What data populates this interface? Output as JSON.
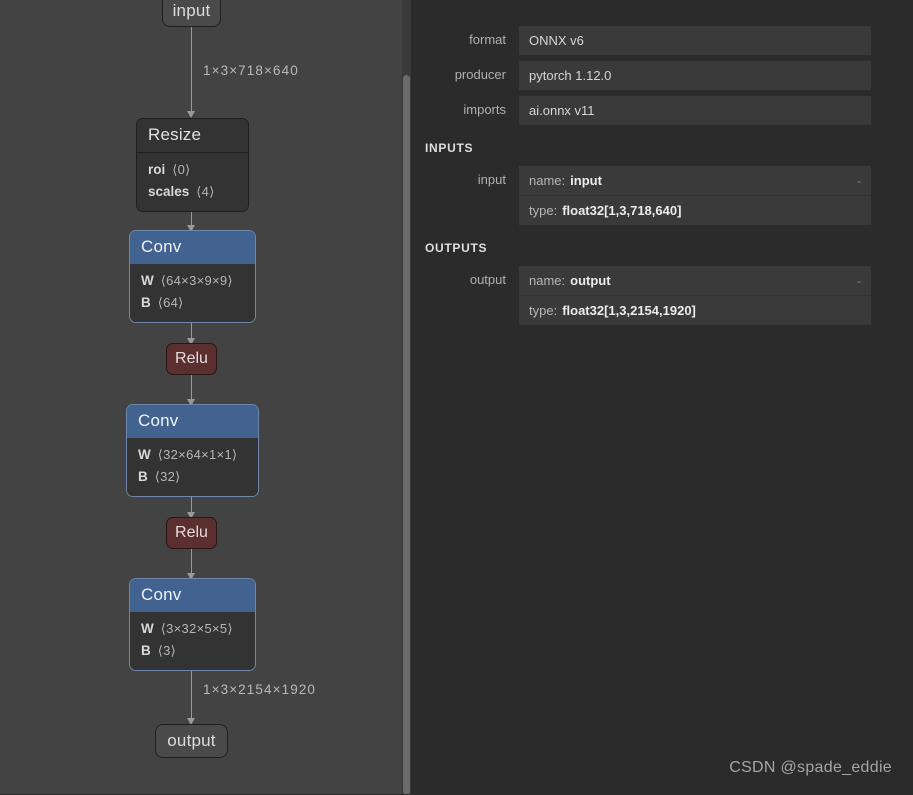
{
  "graph": {
    "nodes": [
      {
        "id": "input",
        "kind": "terminal",
        "label": "input"
      },
      {
        "id": "resize",
        "kind": "box",
        "label": "Resize",
        "header_style": "plain",
        "attributes": [
          {
            "key": "roi",
            "value": "⟨0⟩"
          },
          {
            "key": "scales",
            "value": "⟨4⟩"
          }
        ]
      },
      {
        "id": "conv1",
        "kind": "box",
        "label": "Conv",
        "header_style": "blue",
        "attributes": [
          {
            "key": "W",
            "value": "⟨64×3×9×9⟩"
          },
          {
            "key": "B",
            "value": "⟨64⟩"
          }
        ]
      },
      {
        "id": "relu1",
        "kind": "activation",
        "label": "Relu"
      },
      {
        "id": "conv2",
        "kind": "box",
        "label": "Conv",
        "header_style": "blue",
        "attributes": [
          {
            "key": "W",
            "value": "⟨32×64×1×1⟩"
          },
          {
            "key": "B",
            "value": "⟨32⟩"
          }
        ]
      },
      {
        "id": "relu2",
        "kind": "activation",
        "label": "Relu"
      },
      {
        "id": "conv3",
        "kind": "box",
        "label": "Conv",
        "header_style": "blue",
        "attributes": [
          {
            "key": "W",
            "value": "⟨3×32×5×5⟩"
          },
          {
            "key": "B",
            "value": "⟨3⟩"
          }
        ]
      },
      {
        "id": "output",
        "kind": "terminal",
        "label": "output"
      }
    ],
    "edge_labels": {
      "input_to_resize": "1×3×718×640",
      "conv3_to_output": "1×3×2154×1920"
    }
  },
  "properties": {
    "rows": [
      {
        "label": "format",
        "value": "ONNX v6"
      },
      {
        "label": "producer",
        "value": "pytorch 1.12.0"
      },
      {
        "label": "imports",
        "value": "ai.onnx v11"
      }
    ]
  },
  "inputs": {
    "section_title": "INPUTS",
    "items": [
      {
        "label": "input",
        "name_key": "name:",
        "name_value": "input",
        "type_key": "type:",
        "type_value": "float32[1,3,718,640]",
        "dash": "-"
      }
    ]
  },
  "outputs": {
    "section_title": "OUTPUTS",
    "items": [
      {
        "label": "output",
        "name_key": "name:",
        "name_value": "output",
        "type_key": "type:",
        "type_value": "float32[1,3,2154,1920]",
        "dash": "-"
      }
    ]
  },
  "watermark": {
    "text": "CSDN @spade_eddie"
  },
  "colors": {
    "canvas_bg": "#434343",
    "panel_bg": "#2b2b2b",
    "conv_header": "#42628f",
    "relu_bg": "#5b2f2f",
    "node_bg": "#333333",
    "edge": "#9a9a9a"
  }
}
